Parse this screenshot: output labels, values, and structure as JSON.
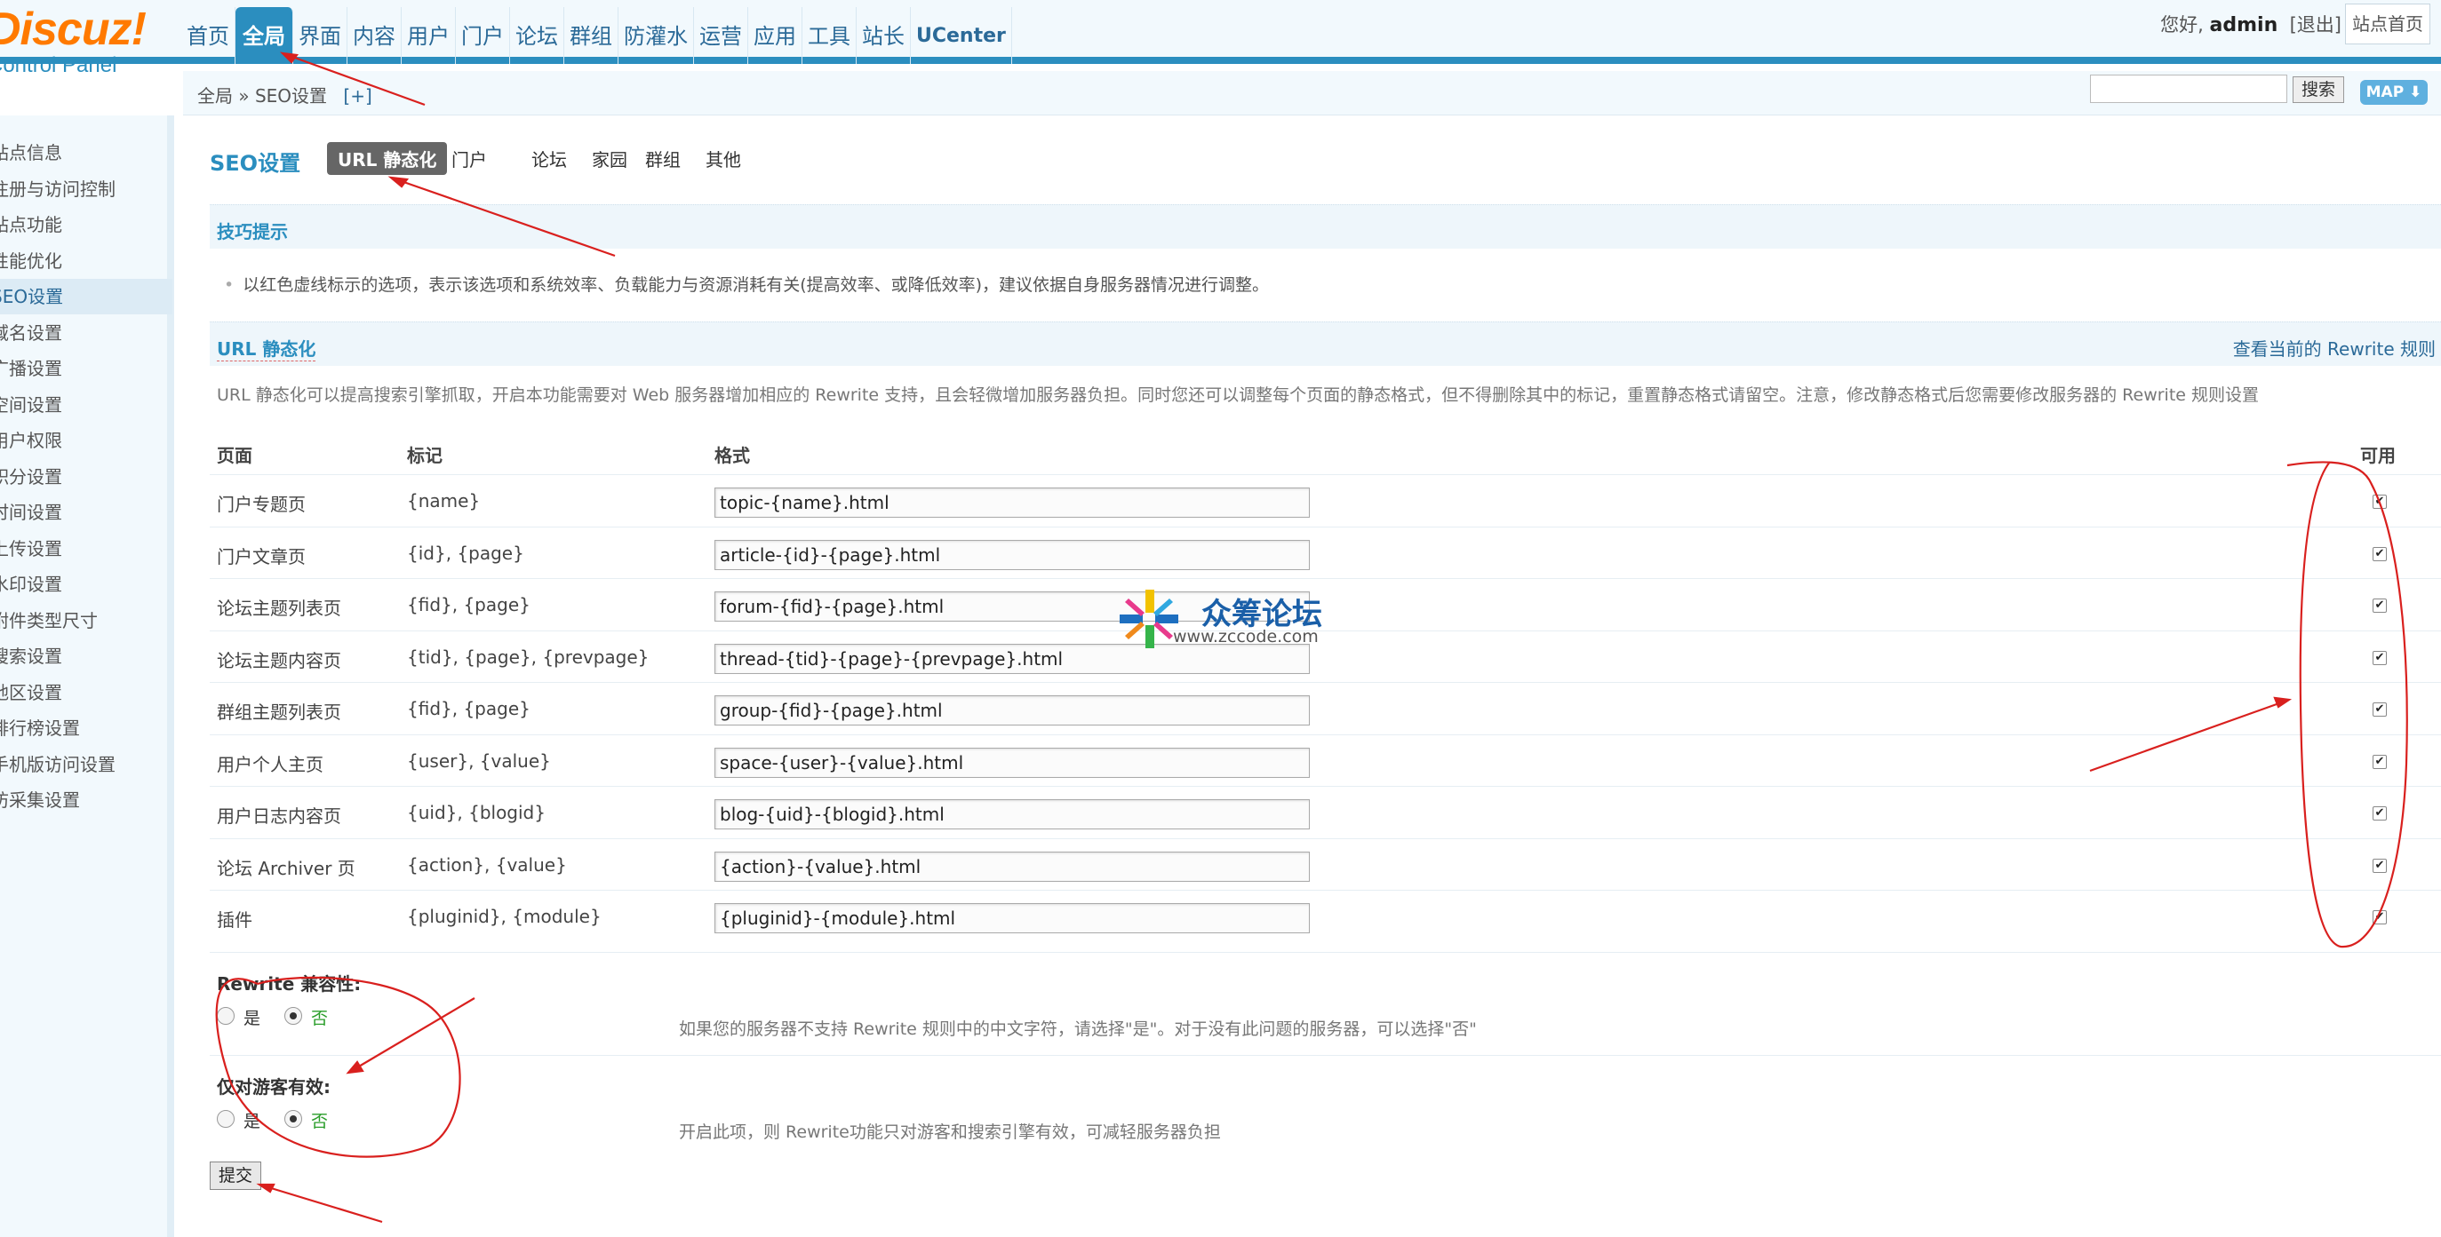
{
  "header": {
    "logo_top": "Discuz!",
    "logo_bottom": "Control Panel",
    "nav": [
      "首页",
      "全局",
      "界面",
      "内容",
      "用户",
      "门户",
      "论坛",
      "群组",
      "防灌水",
      "运营",
      "应用",
      "工具",
      "站长",
      "UCenter"
    ],
    "active_nav": "全局",
    "greeting": "您好,",
    "username": "admin",
    "logout": "[退出]",
    "site_home": "站点首页"
  },
  "breadcrumb": {
    "path": "全局 » SEO设置",
    "plus": "[+]",
    "search_placeholder": "",
    "search_label": "搜索",
    "map_label": "MAP ⬇"
  },
  "sidebar": {
    "items": [
      "站点信息",
      "注册与访问控制",
      "站点功能",
      "性能优化",
      "SEO设置",
      "域名设置",
      "广播设置",
      "空间设置",
      "用户权限",
      "积分设置",
      "时间设置",
      "上传设置",
      "水印设置",
      "附件类型尺寸",
      "搜索设置",
      "地区设置",
      "排行榜设置",
      "手机版访问设置",
      "防采集设置"
    ],
    "visible_labels": [
      "站点信息",
      "注册与访问控制",
      "站点功能",
      "性能优化",
      "SEO设置",
      "域名设置",
      "广播设置",
      "空间设置",
      "用户权限",
      "积分设置",
      "时间设置",
      "上传设置",
      "水印设置",
      "附件类型尺寸",
      "搜索设置",
      "地区设置",
      "排行榜设置",
      "手机版访问设置",
      "防采集设置"
    ],
    "active": "SEO设置"
  },
  "page": {
    "title": "SEO设置",
    "tabs": [
      "URL 静态化",
      "门户",
      "论坛",
      "家园",
      "群组",
      "其他"
    ],
    "active_tab": "URL 静态化"
  },
  "tips": {
    "title": "技巧提示",
    "text": "以红色虚线标示的选项，表示该选项和系统效率、负载能力与资源消耗有关(提高效率、或降低效率)，建议依据自身服务器情况进行调整。"
  },
  "url_static": {
    "title": "URL 静态化",
    "view_rules": "查看当前的 Rewrite 规则",
    "description": "URL 静态化可以提高搜索引擎抓取，开启本功能需要对 Web 服务器增加相应的 Rewrite 支持，且会轻微增加服务器负担。同时您还可以调整每个页面的静态格式，但不得删除其中的标记，重置静态格式请留空。注意，修改静态格式后您需要修改服务器的 Rewrite 规则设置",
    "columns": {
      "page": "页面",
      "mark": "标记",
      "format": "格式",
      "enabled": "可用"
    },
    "rows": [
      {
        "page": "门户专题页",
        "mark": "{name}",
        "format": "topic-{name}.html",
        "enabled": true
      },
      {
        "page": "门户文章页",
        "mark": "{id}, {page}",
        "format": "article-{id}-{page}.html",
        "enabled": true
      },
      {
        "page": "论坛主题列表页",
        "mark": "{fid}, {page}",
        "format": "forum-{fid}-{page}.html",
        "enabled": true
      },
      {
        "page": "论坛主题内容页",
        "mark": "{tid}, {page}, {prevpage}",
        "format": "thread-{tid}-{page}-{prevpage}.html",
        "enabled": true
      },
      {
        "page": "群组主题列表页",
        "mark": "{fid}, {page}",
        "format": "group-{fid}-{page}.html",
        "enabled": true
      },
      {
        "page": "用户个人主页",
        "mark": "{user}, {value}",
        "format": "space-{user}-{value}.html",
        "enabled": true
      },
      {
        "page": "用户日志内容页",
        "mark": "{uid}, {blogid}",
        "format": "blog-{uid}-{blogid}.html",
        "enabled": true
      },
      {
        "page": "论坛 Archiver 页",
        "mark": "{action}, {value}",
        "format": "{action}-{value}.html",
        "enabled": true
      },
      {
        "page": "插件",
        "mark": "{pluginid}, {module}",
        "format": "{pluginid}-{module}.html",
        "enabled": true
      }
    ]
  },
  "settings": {
    "rewrite_compat": {
      "label": "Rewrite 兼容性:",
      "yes": "是",
      "no": "否",
      "selected": "否",
      "note": "如果您的服务器不支持 Rewrite 规则中的中文字符，请选择\"是\"。对于没有此问题的服务器，可以选择\"否\""
    },
    "guest_only": {
      "label": "仅对游客有效:",
      "yes": "是",
      "no": "否",
      "selected": "否",
      "note": "开启此项，则 Rewrite功能只对游客和搜索引擎有效，可减轻服务器负担"
    },
    "submit": "提交"
  },
  "watermark": {
    "title": "众筹论坛",
    "url": "www.zccode.com"
  },
  "colors": {
    "accent": "#2b8ebf",
    "logo_orange": "#ff7a00",
    "annotation_red": "#d9201e",
    "radio_selected_text": "#2a9d2a"
  }
}
